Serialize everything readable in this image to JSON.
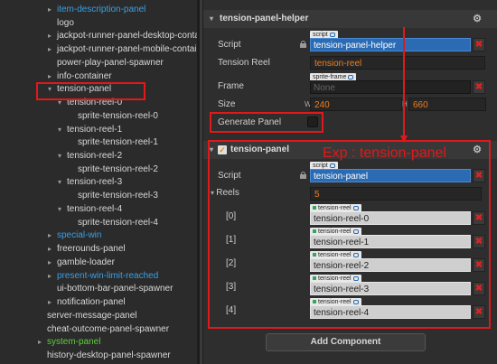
{
  "hierarchy": {
    "items": [
      {
        "label": "item-description-panel",
        "color": "blue",
        "arrow": "▸",
        "indent": 1
      },
      {
        "label": "logo",
        "color": "white",
        "arrow": "",
        "indent": 1
      },
      {
        "label": "jackpot-runner-panel-desktop-containe",
        "color": "white",
        "arrow": "▸",
        "indent": 1
      },
      {
        "label": "jackpot-runner-panel-mobile-container",
        "color": "white",
        "arrow": "▸",
        "indent": 1
      },
      {
        "label": "power-play-panel-spawner",
        "color": "white",
        "arrow": "",
        "indent": 1
      },
      {
        "label": "info-container",
        "color": "white",
        "arrow": "▸",
        "indent": 1
      },
      {
        "label": "tension-panel",
        "color": "white",
        "arrow": "▾",
        "indent": 1
      },
      {
        "label": "tension-reel-0",
        "color": "white",
        "arrow": "▾",
        "indent": 2
      },
      {
        "label": "sprite-tension-reel-0",
        "color": "white",
        "arrow": "",
        "indent": 3
      },
      {
        "label": "tension-reel-1",
        "color": "white",
        "arrow": "▾",
        "indent": 2
      },
      {
        "label": "sprite-tension-reel-1",
        "color": "white",
        "arrow": "",
        "indent": 3
      },
      {
        "label": "tension-reel-2",
        "color": "white",
        "arrow": "▾",
        "indent": 2
      },
      {
        "label": "sprite-tension-reel-2",
        "color": "white",
        "arrow": "",
        "indent": 3
      },
      {
        "label": "tension-reel-3",
        "color": "white",
        "arrow": "▾",
        "indent": 2
      },
      {
        "label": "sprite-tension-reel-3",
        "color": "white",
        "arrow": "",
        "indent": 3
      },
      {
        "label": "tension-reel-4",
        "color": "white",
        "arrow": "▾",
        "indent": 2
      },
      {
        "label": "sprite-tension-reel-4",
        "color": "white",
        "arrow": "",
        "indent": 3
      },
      {
        "label": "special-win",
        "color": "blue",
        "arrow": "▸",
        "indent": 1
      },
      {
        "label": "freerounds-panel",
        "color": "white",
        "arrow": "▸",
        "indent": 1
      },
      {
        "label": "gamble-loader",
        "color": "white",
        "arrow": "▸",
        "indent": 1
      },
      {
        "label": "present-win-limit-reached",
        "color": "blue",
        "arrow": "▸",
        "indent": 1
      },
      {
        "label": "ui-bottom-bar-panel-spawner",
        "color": "white",
        "arrow": "",
        "indent": 1
      },
      {
        "label": "notification-panel",
        "color": "white",
        "arrow": "▸",
        "indent": 1
      },
      {
        "label": "server-message-panel",
        "color": "white",
        "arrow": "",
        "indent": 0
      },
      {
        "label": "cheat-outcome-panel-spawner",
        "color": "white",
        "arrow": "",
        "indent": 0
      },
      {
        "label": "system-panel",
        "color": "green",
        "arrow": "▸",
        "indent": 0
      },
      {
        "label": "history-desktop-panel-spawner",
        "color": "white",
        "arrow": "",
        "indent": 0
      }
    ]
  },
  "helper": {
    "title": "tension-panel-helper",
    "script_label": "Script",
    "script_tag": "script",
    "script_value": "tension-panel-helper",
    "reel_label": "Tension Reel",
    "reel_value": "tension-reel",
    "frame_label": "Frame",
    "frame_tag": "sprite-frame",
    "frame_placeholder": "None",
    "size_label": "Size",
    "size_w_axis": "W",
    "size_w": "240",
    "size_h_axis": "H",
    "size_h": "660",
    "generate_label": "Generate Panel"
  },
  "panel": {
    "title": "tension-panel",
    "annotation": "Exp : tension-panel",
    "script_label": "Script",
    "script_tag": "script",
    "script_value": "tension-panel",
    "reels_label": "Reels",
    "reels_count": "5",
    "reels": [
      {
        "index": "[0]",
        "tag": "tension-reel",
        "value": "tension-reel-0"
      },
      {
        "index": "[1]",
        "tag": "tension-reel",
        "value": "tension-reel-1"
      },
      {
        "index": "[2]",
        "tag": "tension-reel",
        "value": "tension-reel-2"
      },
      {
        "index": "[3]",
        "tag": "tension-reel",
        "value": "tension-reel-3"
      },
      {
        "index": "[4]",
        "tag": "tension-reel",
        "value": "tension-reel-4"
      }
    ]
  },
  "add_component_label": "Add Component",
  "colors": {
    "highlight": "#e0191b",
    "blue_node": "#3aa0e6",
    "green_node": "#5fcf3d",
    "value_orange": "#f07e1e"
  }
}
